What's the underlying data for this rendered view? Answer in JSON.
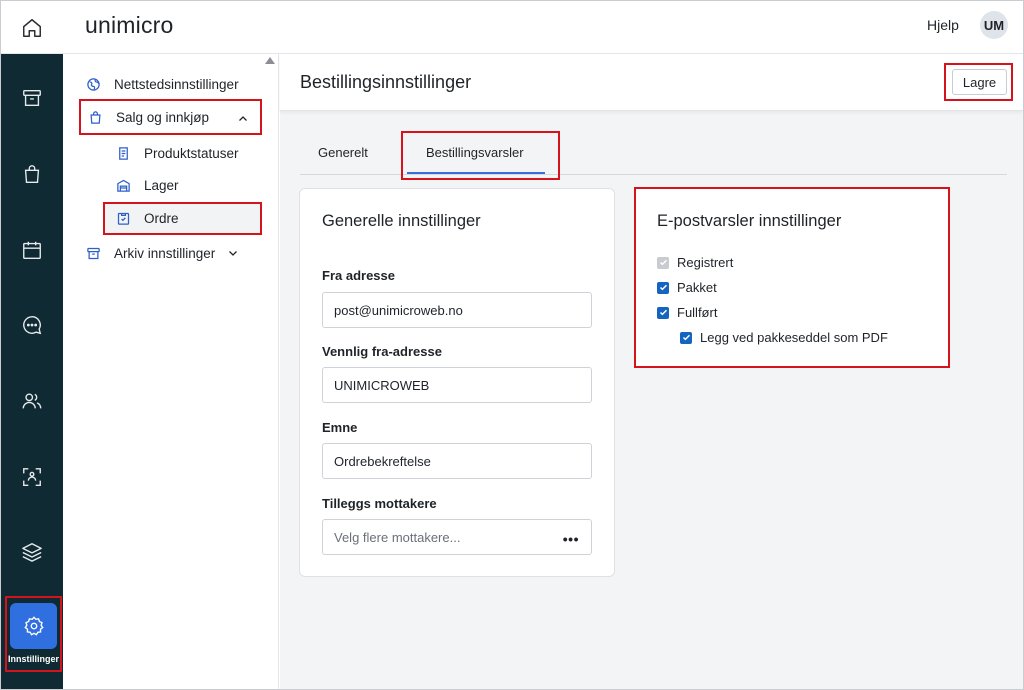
{
  "app": {
    "logo": "unimicro"
  },
  "header": {
    "help": "Hjelp",
    "avatar_initials": "UM"
  },
  "rail": {
    "items": [
      "home-icon",
      "archive-icon",
      "shopping-bag-icon",
      "calendar-icon",
      "chat-icon",
      "users-icon",
      "scan-icon",
      "layers-icon"
    ],
    "settings_label": "Innstillinger"
  },
  "subnav": {
    "site_settings": "Nettstedsinnstillinger",
    "sales": "Salg og innkjøp",
    "product_statuses": "Produktstatuser",
    "stock": "Lager",
    "orders": "Ordre",
    "archive": "Arkiv innstillinger"
  },
  "page": {
    "title": "Bestillingsinnstillinger",
    "save_label": "Lagre",
    "tabs": [
      "Generelt",
      "Bestillingsvarsler"
    ]
  },
  "general": {
    "title": "Generelle innstillinger",
    "from_label": "Fra adresse",
    "from_value": "post@unimicroweb.no",
    "friendly_label": "Vennlig fra-adresse",
    "friendly_value": "UNIMICROWEB",
    "subject_label": "Emne",
    "subject_value": "Ordrebekreftelse",
    "recipients_label": "Tilleggs mottakere",
    "recipients_placeholder": "Velg flere mottakere...",
    "more_label": "•••"
  },
  "email": {
    "title": "E-postvarsler innstillinger",
    "options": [
      {
        "label": "Registrert",
        "checked": true,
        "disabled": true
      },
      {
        "label": "Pakket",
        "checked": true,
        "disabled": false
      },
      {
        "label": "Fullført",
        "checked": true,
        "disabled": false
      },
      {
        "label": "Legg ved pakkeseddel som PDF",
        "checked": true,
        "disabled": false
      }
    ]
  },
  "colors": {
    "rail": "#0f2a33",
    "accent": "#2f6fe0",
    "highlight": "#d3141c",
    "check": "#1565c0"
  }
}
